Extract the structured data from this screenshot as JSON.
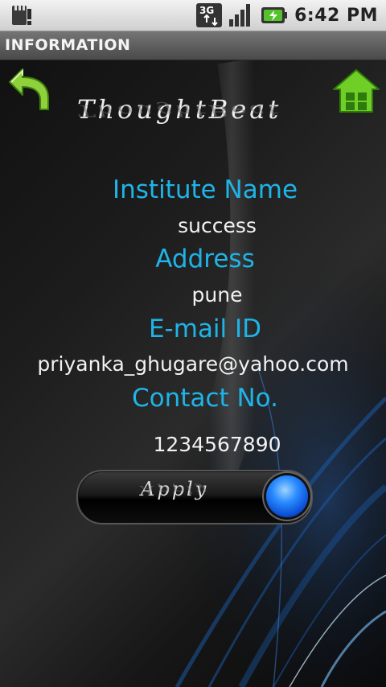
{
  "status_bar": {
    "network": "3G",
    "time": "6:42 PM"
  },
  "title_bar": {
    "title": "INFORMATION"
  },
  "brand": {
    "text": "ThoughtBeat"
  },
  "fields": [
    {
      "label": "Institute Name",
      "value": "success"
    },
    {
      "label": "Address",
      "value": "pune"
    },
    {
      "label": "E-mail ID",
      "value": "priyanka_ghugare@yahoo.com"
    },
    {
      "label": "Contact No.",
      "value": "1234567890"
    }
  ],
  "apply_button": {
    "label": "Apply"
  },
  "colors": {
    "label": "#1fb4e8",
    "value": "#f2f2f2"
  },
  "icons": {
    "back": "back-arrow-icon",
    "home": "home-icon"
  }
}
